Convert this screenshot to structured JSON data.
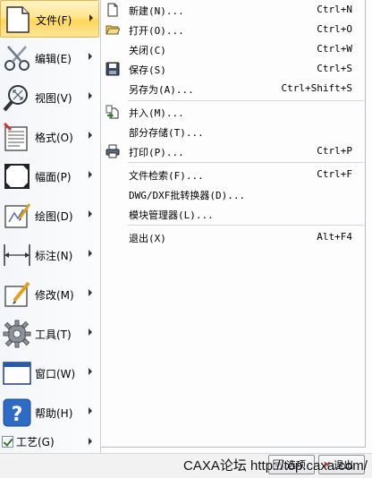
{
  "main_menu": {
    "items": [
      {
        "label": "文件(F)",
        "icon": "document-icon"
      },
      {
        "label": "编辑(E)",
        "icon": "scissors-icon"
      },
      {
        "label": "视图(V)",
        "icon": "zoom-icon"
      },
      {
        "label": "格式(O)",
        "icon": "format-icon"
      },
      {
        "label": "幅面(P)",
        "icon": "frame-icon"
      },
      {
        "label": "绘图(D)",
        "icon": "draw-icon"
      },
      {
        "label": "标注(N)",
        "icon": "dimension-icon"
      },
      {
        "label": "修改(M)",
        "icon": "modify-icon"
      },
      {
        "label": "工具(T)",
        "icon": "gear-icon"
      },
      {
        "label": "窗口(W)",
        "icon": "window-icon"
      },
      {
        "label": "帮助(H)",
        "icon": "help-icon"
      }
    ],
    "craft": {
      "label": "工艺(G)"
    }
  },
  "file_menu": {
    "items": [
      {
        "label": "新建(N)...",
        "shortcut": "Ctrl+N",
        "icon": "new-file-icon"
      },
      {
        "label": "打开(O)...",
        "shortcut": "Ctrl+O",
        "icon": "open-folder-icon"
      },
      {
        "label": "关闭(C)",
        "shortcut": "Ctrl+W",
        "icon": ""
      },
      {
        "label": "保存(S)",
        "shortcut": "Ctrl+S",
        "icon": "save-icon"
      },
      {
        "label": "另存为(A)...",
        "shortcut": "Ctrl+Shift+S",
        "icon": ""
      },
      {
        "label": "并入(M)...",
        "shortcut": "",
        "icon": "merge-icon"
      },
      {
        "label": "部分存储(T)...",
        "shortcut": "",
        "icon": ""
      },
      {
        "label": "打印(P)...",
        "shortcut": "Ctrl+P",
        "icon": "print-icon"
      },
      {
        "label": "文件检索(F)...",
        "shortcut": "Ctrl+F",
        "icon": ""
      },
      {
        "label": "DWG/DXF批转换器(D)...",
        "shortcut": "",
        "icon": ""
      },
      {
        "label": "模块管理器(L)...",
        "shortcut": "",
        "icon": ""
      },
      {
        "label": "退出(X)",
        "shortcut": "Alt+F4",
        "icon": ""
      }
    ]
  },
  "footer": {
    "options_label": "选项",
    "exit_label": "退出",
    "watermark": "CAXA论坛 http://top.caxa.com/"
  },
  "colors": {
    "highlight": "#ffd65a",
    "menu_background": "#fdfdfd",
    "separator": "#d4d8de"
  }
}
